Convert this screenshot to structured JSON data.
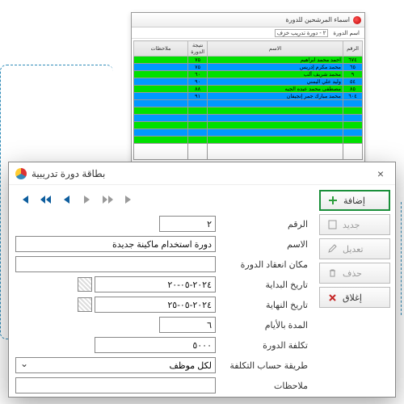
{
  "bgWindow": {
    "title": "اسماء المرشحين للدورة",
    "filterLabel": "اسم الدورة",
    "filterCombo": "٢ - دورة تدريب خزف",
    "columns": [
      "الرقم",
      "الاسم",
      "نتيجة الدورة",
      "ملاحظات"
    ],
    "rows": [
      {
        "num": "٦٧٤",
        "name": "احمد محمد ابراهيم",
        "result": "٧٥"
      },
      {
        "num": "٦٥",
        "name": "محمد مكرم إدريس",
        "result": "٧٥"
      },
      {
        "num": "٩",
        "name": "محمد شريف ألب",
        "result": "٦٠"
      },
      {
        "num": "٥٤",
        "name": "وليد علي اليمني",
        "result": "٩٠"
      },
      {
        "num": "٨٥",
        "name": "مصطفى محمد عبده الجبه",
        "result": "٨٨"
      },
      {
        "num": "٦٠٤",
        "name": "محمد مبارك جمر إنجيفان",
        "result": "٩١"
      }
    ]
  },
  "dialog": {
    "title": "بطاقة دورة تدريبية",
    "buttons": {
      "add": "إضافة",
      "new": "جديد",
      "edit": "تعديل",
      "delete": "حذف",
      "close": "إغلاق"
    },
    "labels": {
      "id": "الرقم",
      "name": "الاسم",
      "location": "مكان انعقاد الدورة",
      "startDate": "تاريخ البداية",
      "endDate": "تاريخ النهاية",
      "durationDays": "المدة بالأيام",
      "cost": "تكلفة الدورة",
      "costMethod": "طريقة حساب التكلفة",
      "notes": "ملاحظات"
    },
    "values": {
      "id": "٢",
      "name": "دورة استخدام ماكينة جديدة",
      "location": "",
      "startDate": "٢٠٢٤-٠٥-٢٠",
      "endDate": "٢٠٢٤-٠٥-٢٥",
      "durationDays": "٦",
      "cost": "٥٠٠٠",
      "costMethod": "لكل موظف",
      "notes": ""
    }
  }
}
